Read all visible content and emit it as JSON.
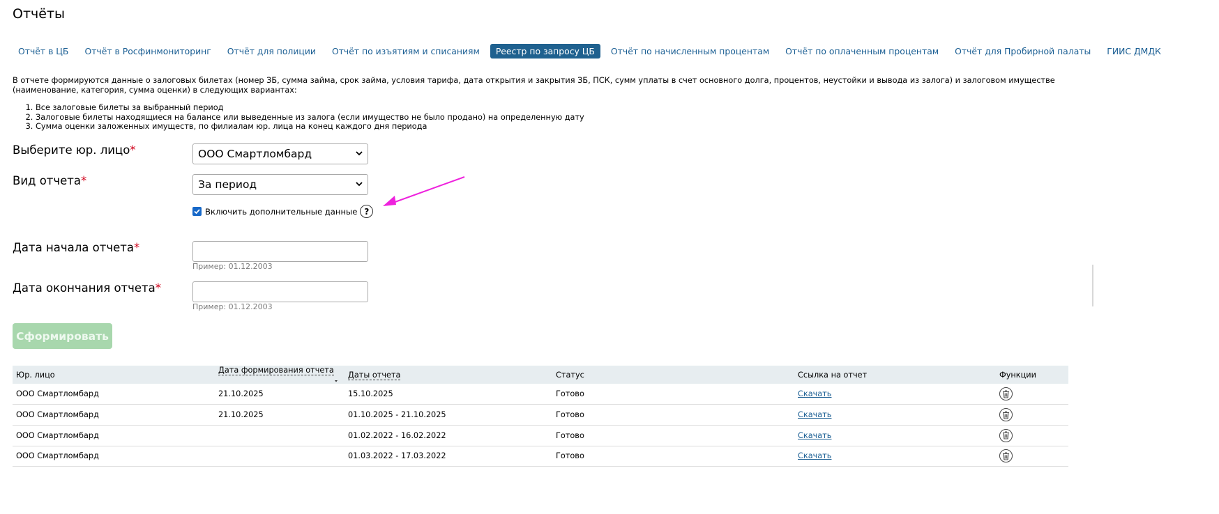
{
  "page": {
    "title": "Отчёты"
  },
  "tabs": [
    {
      "label": "Отчёт в ЦБ",
      "active": false
    },
    {
      "label": "Отчёт в Росфинмониторинг",
      "active": false
    },
    {
      "label": "Отчёт для полиции",
      "active": false
    },
    {
      "label": "Отчёт по изъятиям и списаниям",
      "active": false
    },
    {
      "label": "Реестр по запросу ЦБ",
      "active": true
    },
    {
      "label": "Отчёт по начисленным процентам",
      "active": false
    },
    {
      "label": "Отчёт по оплаченным процентам",
      "active": false
    },
    {
      "label": "Отчёт для Пробирной палаты",
      "active": false
    },
    {
      "label": "ГИИС ДМДК",
      "active": false
    }
  ],
  "description": {
    "intro": "В отчете формируются данные о залоговых билетах (номер ЗБ, сумма займа, срок займа, условия тарифа, дата открытия и закрытия ЗБ, ПСК, сумм уплаты в счет основного долга, процентов, неустойки и вывода из залога) и залоговом имуществе (наименование, категория, сумма оценки) в следующих вариантах:",
    "items": [
      "Все залоговые билеты за выбранный период",
      "Залоговые билеты находящиеся на балансе или выведенные из залога (если имущество не было продано) на определенную дату",
      "Сумма оценки заложенных имуществ, по филиалам юр. лица на конец каждого дня периода"
    ]
  },
  "form": {
    "required_mark": "*",
    "legal_entity": {
      "label": "Выберите юр. лицо",
      "value": "ООО Смартломбард"
    },
    "report_type": {
      "label": "Вид отчета",
      "value": "За период"
    },
    "extra_data": {
      "label": "Включить дополнительные данные",
      "checked": true,
      "help": "?"
    },
    "start_date": {
      "label": "Дата начала отчета",
      "value": "",
      "hint": "Пример: 01.12.2003"
    },
    "end_date": {
      "label": "Дата окончания отчета",
      "value": "",
      "hint": "Пример: 01.12.2003"
    },
    "submit_label": "Сформировать"
  },
  "annotation_color": "#ee22dd",
  "table": {
    "headers": [
      "Юр. лицо",
      "Дата формирования отчета",
      "Даты отчета",
      "Статус",
      "Ссылка на отчет",
      "Функции"
    ],
    "rows": [
      {
        "entity": "ООО Смартломбард",
        "created": "21.10.2025",
        "dates": "15.10.2025",
        "status": "Готово",
        "link": "Скачать"
      },
      {
        "entity": "ООО Смартломбард",
        "created": "21.10.2025",
        "dates": "01.10.2025 - 21.10.2025",
        "status": "Готово",
        "link": "Скачать"
      },
      {
        "entity": "ООО Смартломбард",
        "created": "",
        "dates": "01.02.2022 - 16.02.2022",
        "status": "Готово",
        "link": "Скачать"
      },
      {
        "entity": "ООО Смартломбард",
        "created": "",
        "dates": "01.03.2022 - 17.03.2022",
        "status": "Готово",
        "link": "Скачать"
      }
    ]
  }
}
